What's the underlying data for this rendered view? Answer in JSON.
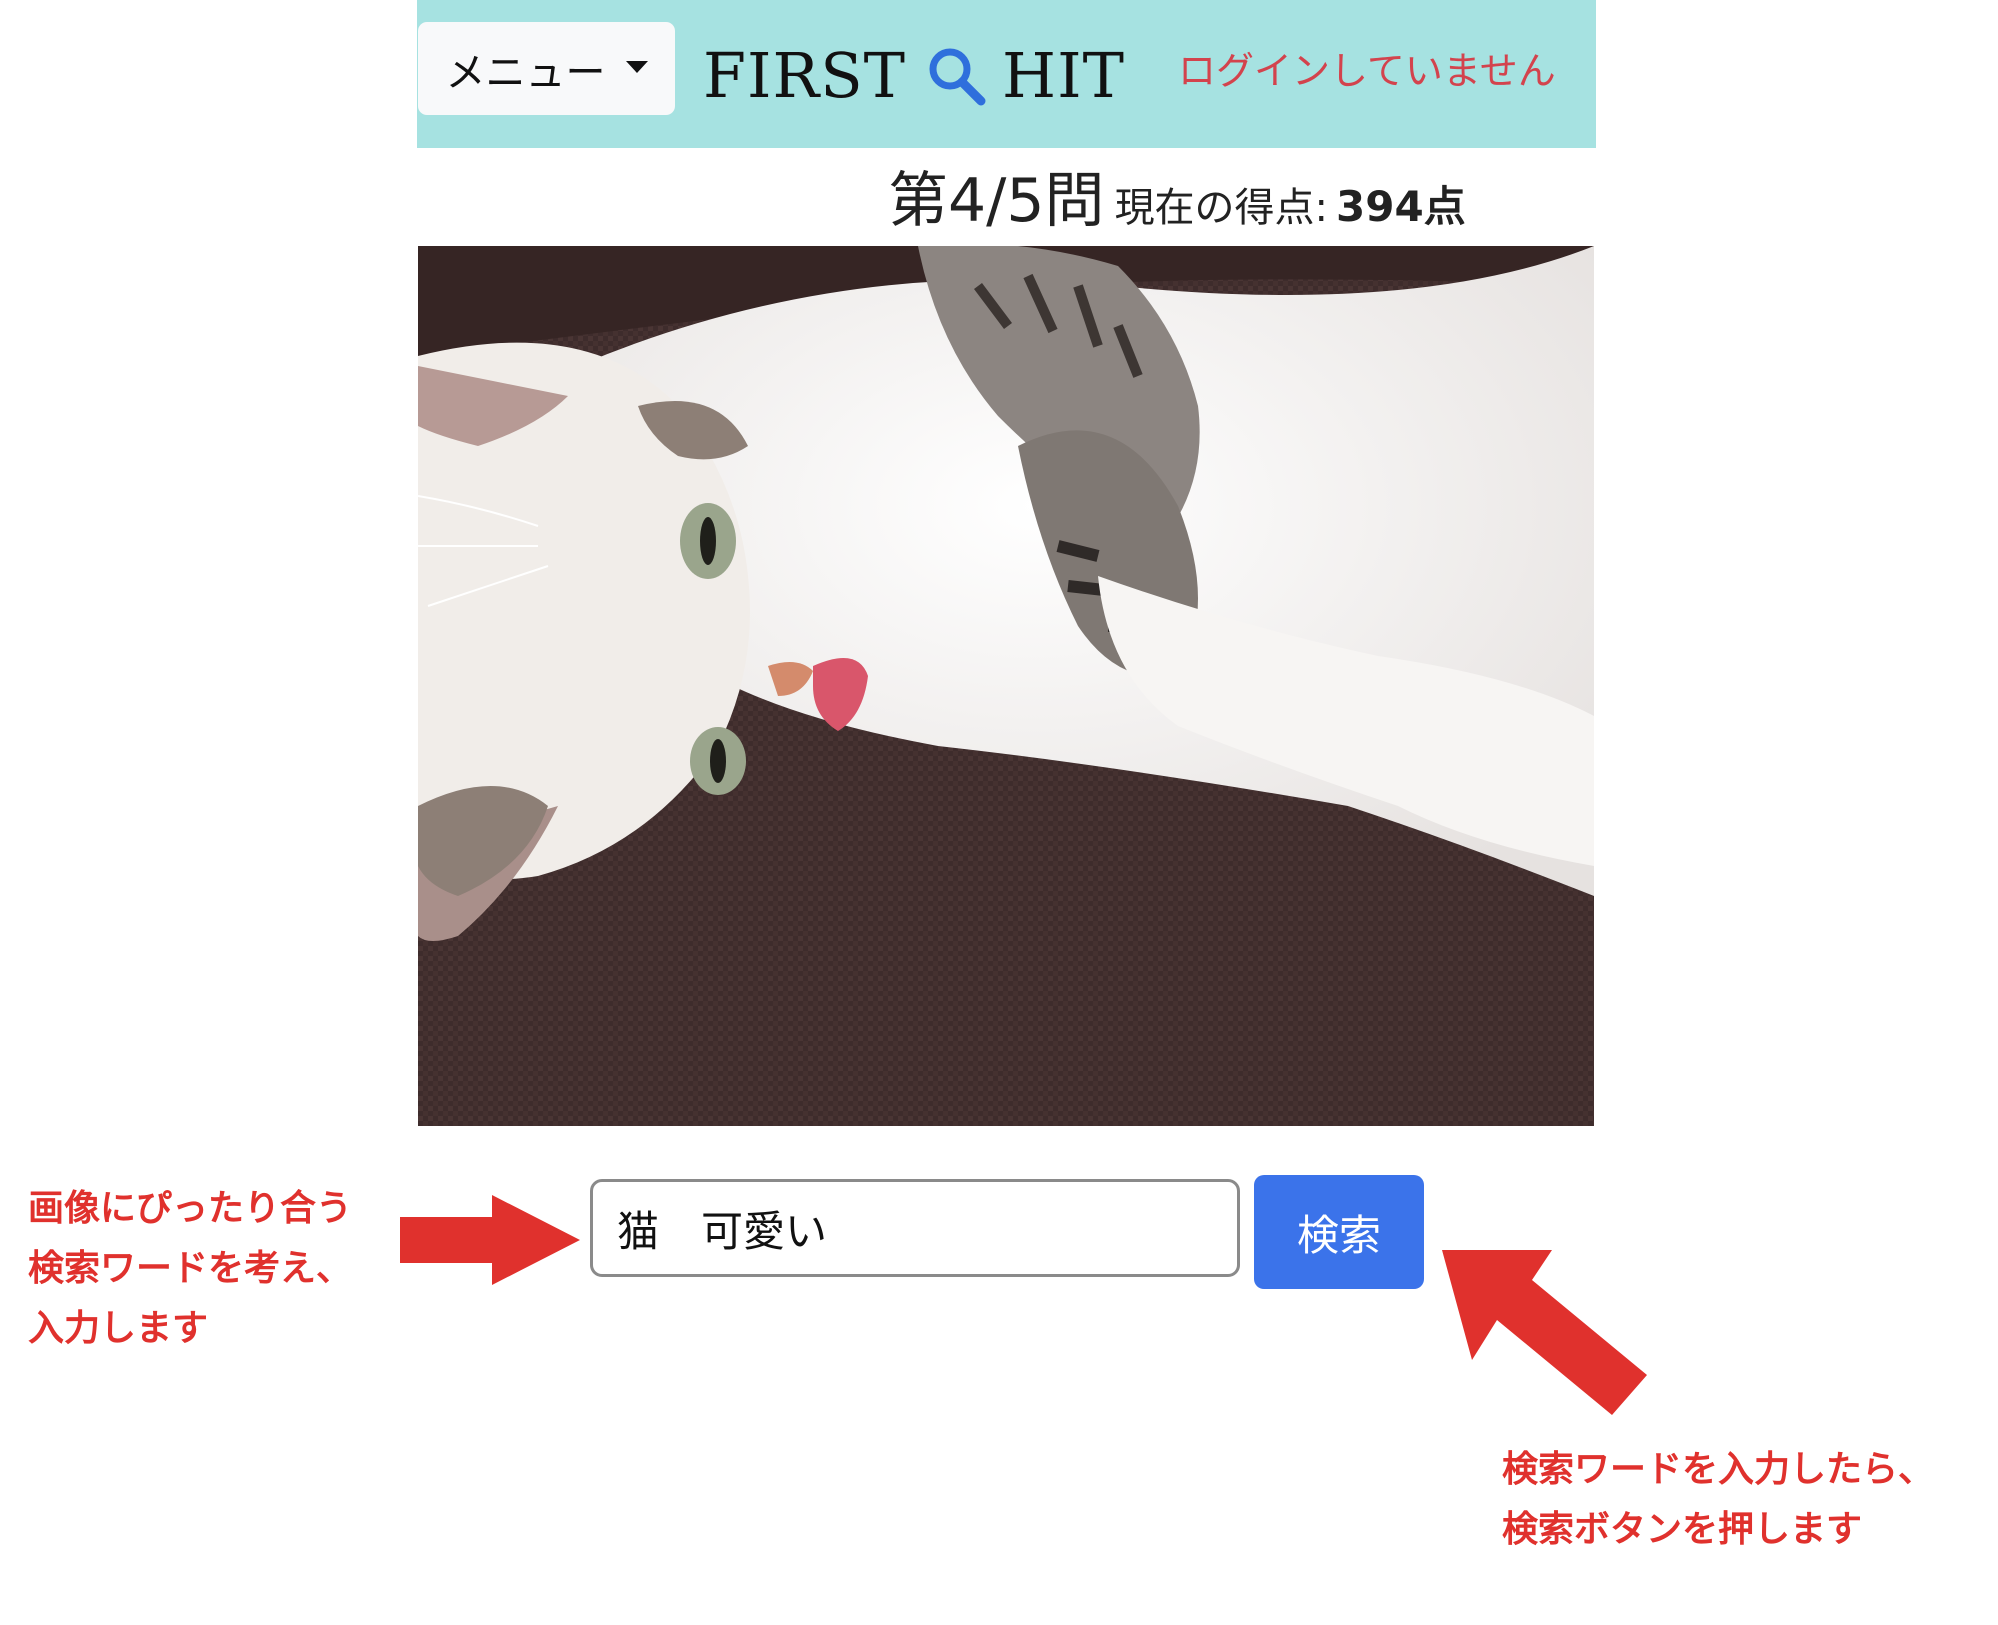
{
  "header": {
    "menu_label": "メニュー",
    "logo_left": "FIRST",
    "logo_right": "HIT",
    "login_status": "ログインしていません",
    "background_color": "#a6e2e1",
    "login_status_color": "#d3434d",
    "logo_icon": "search-icon"
  },
  "quiz": {
    "question_counter": "第4/5問",
    "score_label": "現在の得点:",
    "score_value": "394点"
  },
  "search": {
    "input_value": "猫　可愛い",
    "button_label": "検索",
    "button_color": "#3b73ea"
  },
  "annotations": {
    "left_lines": [
      "画像にぴったり合う",
      "検索ワードを考え、",
      "入力します"
    ],
    "right_lines": [
      "検索ワードを入力したら、",
      "検索ボタンを押します"
    ],
    "color": "#e0312d"
  }
}
